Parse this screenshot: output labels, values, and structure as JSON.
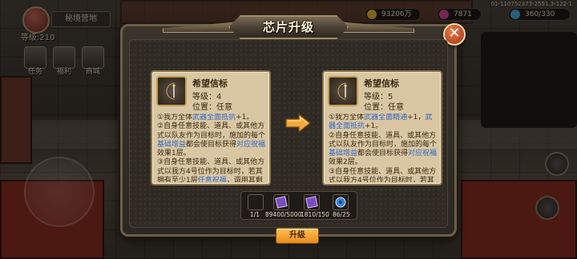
{
  "hud": {
    "player_name": "秘境营地",
    "level": "等级:210",
    "buttons": [
      "任务",
      "福利",
      "商城"
    ],
    "server_id": "01-110752373-2551.3-122-1",
    "resources": [
      "93206万",
      "7871",
      "360/330"
    ]
  },
  "dialog": {
    "title": "芯片升级",
    "close_label": "✕",
    "upgrade_label": "升级"
  },
  "current_chip": {
    "name": "希望信标",
    "level": "等级：4",
    "position": "位置：任意",
    "desc": [
      {
        "t": "①我方全体"
      },
      {
        "t": "武器全面抵抗",
        "hl": true
      },
      {
        "t": "+1。"
      },
      {
        "br": true
      },
      {
        "t": "②自身任意技能、道具、或其他方式以队友作为目标时，施加的每个"
      },
      {
        "t": "基础增益",
        "hl": true
      },
      {
        "t": "都会使目标获得"
      },
      {
        "t": "对应祝福",
        "hl": true
      },
      {
        "t": "效果1层。"
      },
      {
        "br": true
      },
      {
        "t": "③自身任意技能、道具、或其他方式以我方4号位作为目标时，若其拥有至少1层"
      },
      {
        "t": "任意祝福",
        "hl": true
      },
      {
        "t": "，调用其剩"
      }
    ]
  },
  "next_chip": {
    "name": "希望信标",
    "level": "等级：5",
    "position": "位置：任意",
    "desc": [
      {
        "t": "①我方全体"
      },
      {
        "t": "武器全面精通",
        "hl": true
      },
      {
        "t": "+1，"
      },
      {
        "t": "武器全面抵抗",
        "hl": true
      },
      {
        "t": "+1。"
      },
      {
        "br": true
      },
      {
        "t": "②自身任意技能、道具、或其他方式以队友作为目标时，施加的每个"
      },
      {
        "t": "基础增益",
        "hl": true
      },
      {
        "t": "都会使目标获得"
      },
      {
        "t": "对应祝福",
        "hl": true
      },
      {
        "t": "效果2层。"
      },
      {
        "br": true
      },
      {
        "t": "③自身任意技能、道具、或其他方式以我方4号位作为目标时，若其"
      }
    ]
  },
  "materials": [
    {
      "icon": "chip-icon",
      "count": "1/1",
      "color": "#3b3328"
    },
    {
      "icon": "purple-book-icon",
      "count": "89400/5000",
      "color": "#6b3fa8"
    },
    {
      "icon": "purple-book-icon",
      "count": "1810/150",
      "color": "#6b3fa8"
    },
    {
      "icon": "blue-gear-icon",
      "count": "86/25",
      "color": "#2f6fb3"
    }
  ],
  "colors": {
    "highlight": "#2f64c8",
    "upgrade_button": "#ec8a1b",
    "close_button": "#c8522a"
  }
}
